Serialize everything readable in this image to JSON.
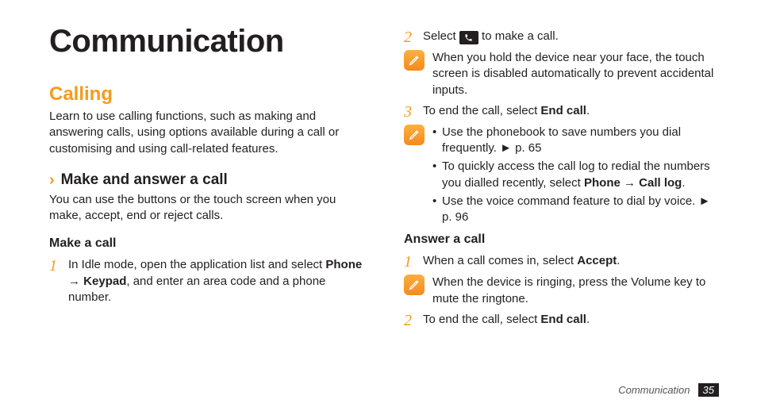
{
  "page_title": "Communication",
  "section": {
    "title": "Calling",
    "intro": "Learn to use calling functions, such as making and answering calls, using options available during a call or customising and using call-related features."
  },
  "subsection1": {
    "title": "Make and answer a call",
    "text": "You can use the buttons or the touch screen when you make, accept, end or reject calls."
  },
  "make_call": {
    "heading": "Make a call",
    "step1_num": "1",
    "step1_a": "In Idle mode, open the application list and select ",
    "step1_b": "Phone",
    "step1_arrow": " → ",
    "step1_c": "Keypad",
    "step1_d": ", and enter an area code and a phone number.",
    "step2_num": "2",
    "step2_a": "Select ",
    "step2_b": " to make a call.",
    "note1": "When you hold the device near your face, the touch screen is disabled automatically to prevent accidental inputs.",
    "step3_num": "3",
    "step3_a": "To end the call, select ",
    "step3_b": "End call",
    "step3_c": ".",
    "note2_li1_a": "Use the phonebook to save numbers you dial frequently. ► p. 65",
    "note2_li2_a": "To quickly access the call log to redial the numbers you dialled recently, select ",
    "note2_li2_b": "Phone",
    "note2_li2_arrow": " → ",
    "note2_li2_c": "Call log",
    "note2_li2_d": ".",
    "note2_li3_a": "Use the voice command feature to dial by voice. ► p. 96"
  },
  "answer_call": {
    "heading": "Answer a call",
    "step1_num": "1",
    "step1_a": "When a call comes in, select ",
    "step1_b": "Accept",
    "step1_c": ".",
    "note1": "When the device is ringing, press the Volume key to mute the ringtone.",
    "step2_num": "2",
    "step2_a": "To end the call, select ",
    "step2_b": "End call",
    "step2_c": "."
  },
  "footer": {
    "title": "Communication",
    "page": "35"
  }
}
